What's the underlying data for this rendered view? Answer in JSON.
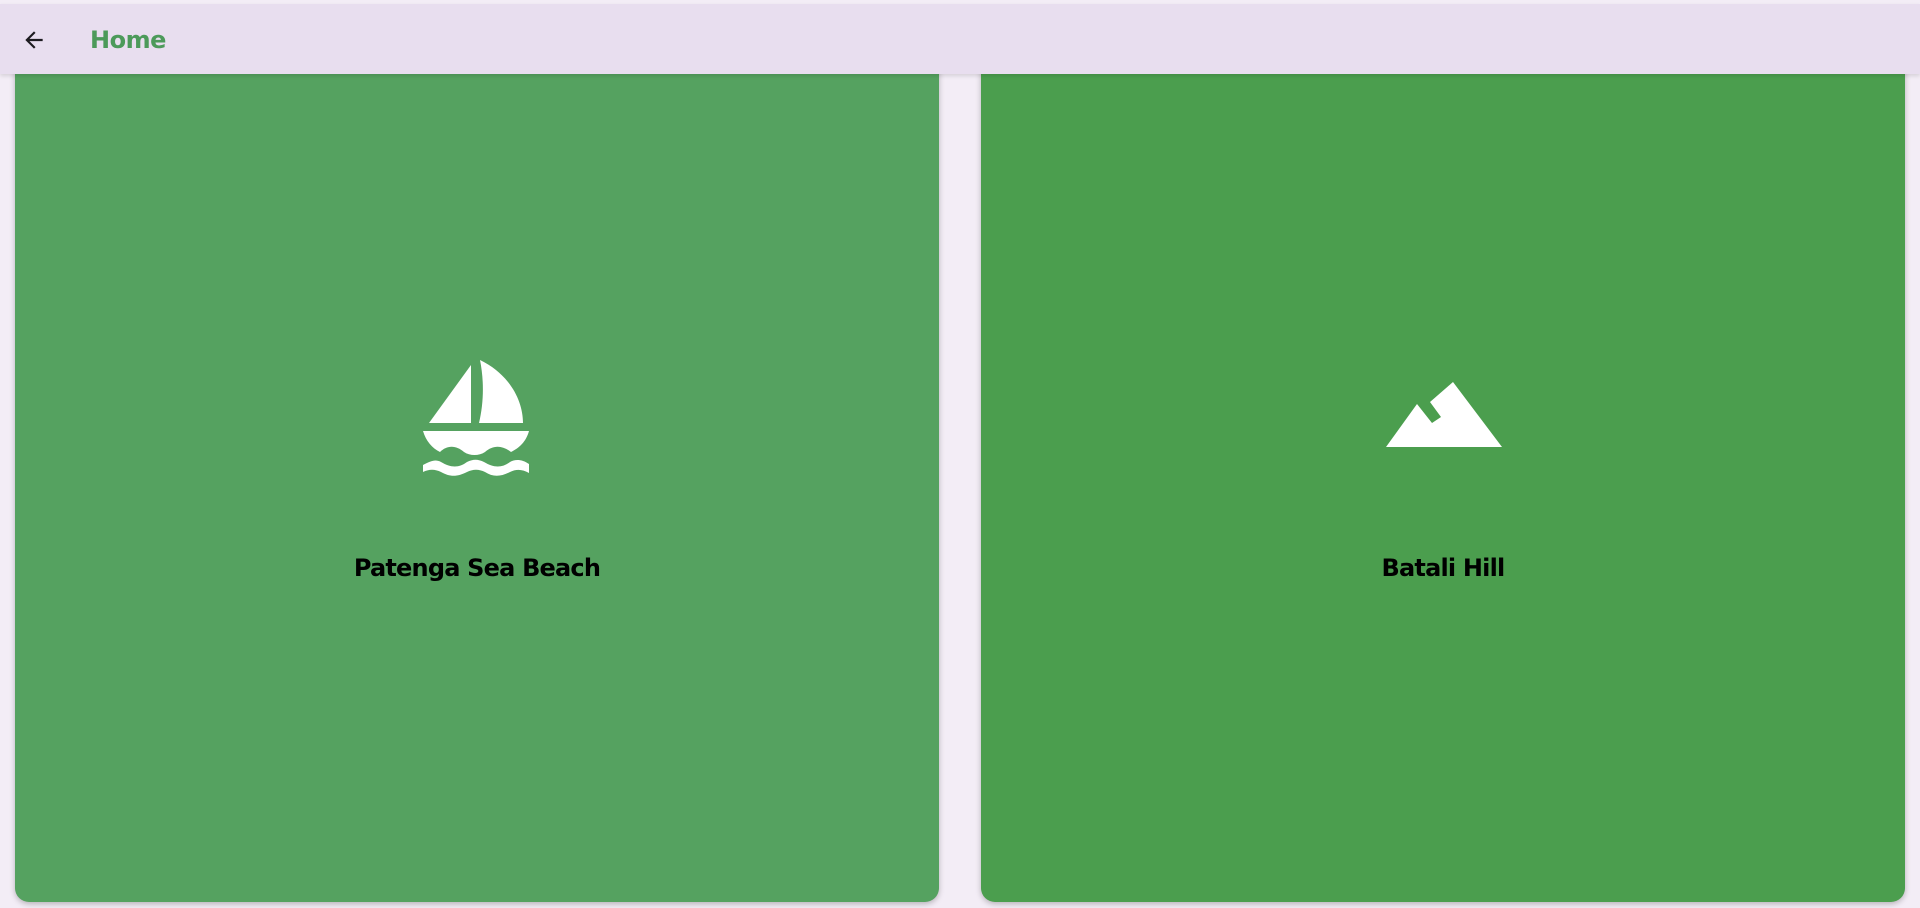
{
  "appbar": {
    "title": "Home",
    "background": "#e8deef",
    "title_color": "#4c9a5a",
    "back_icon": "arrow-back-icon"
  },
  "cards": [
    {
      "label": "Patenga Sea Beach",
      "icon": "sailboat-icon",
      "color": "#55a260"
    },
    {
      "label": "Batali Hill",
      "icon": "mountain-icon",
      "color": "#4b9e4e"
    }
  ]
}
